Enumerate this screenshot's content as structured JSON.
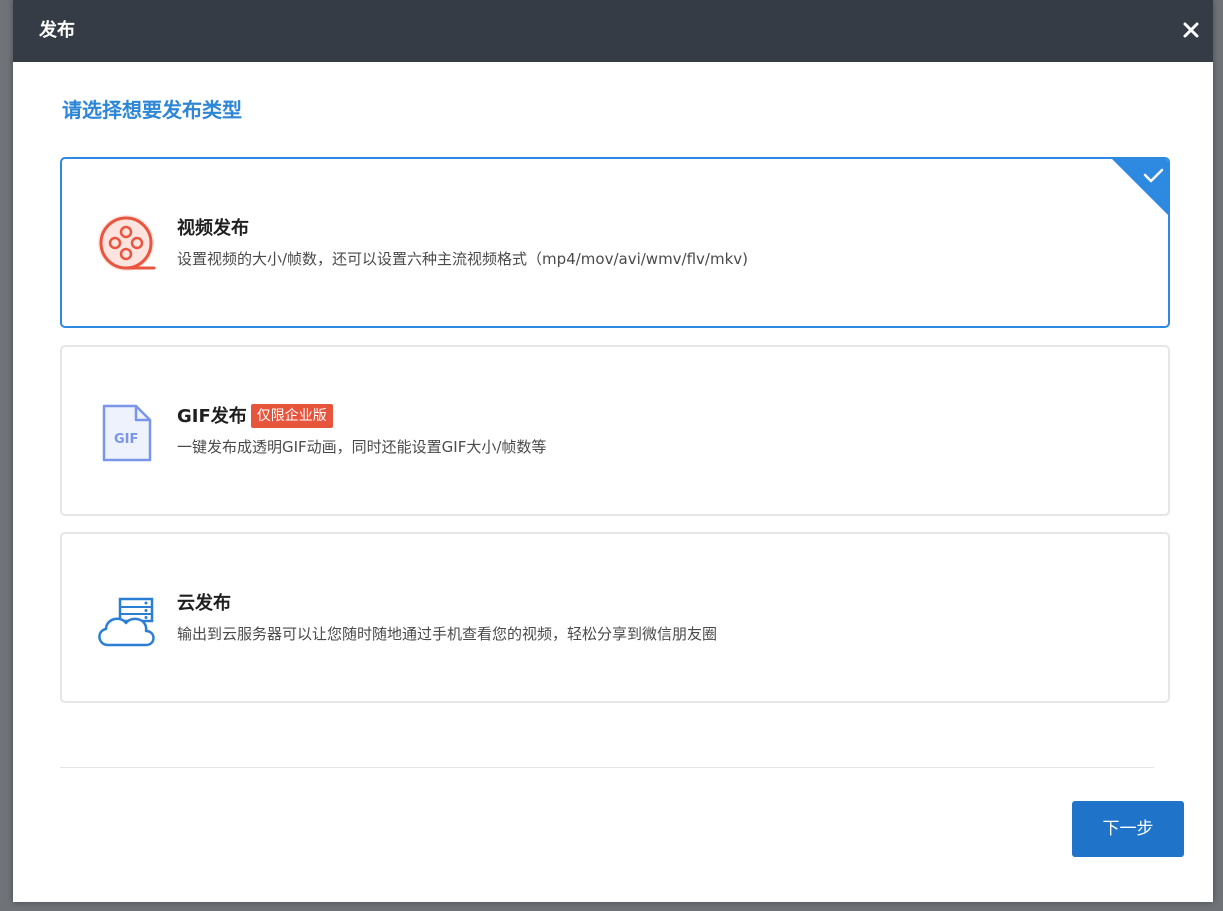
{
  "dialog": {
    "title": "发布",
    "close_icon": "close-icon"
  },
  "heading": "请选择想要发布类型",
  "options": [
    {
      "title": "视频发布",
      "description": "设置视频的大小/帧数，还可以设置六种主流视频格式（mp4/mov/avi/wmv/flv/mkv)",
      "icon": "film-reel-icon",
      "selected": true
    },
    {
      "title": "GIF发布",
      "badge": "仅限企业版",
      "description": "一键发布成透明GIF动画，同时还能设置GIF大小/帧数等",
      "icon": "gif-file-icon",
      "icon_text": "GIF",
      "selected": false
    },
    {
      "title": "云发布",
      "description": "输出到云服务器可以让您随时随地通过手机查看您的视频，轻松分享到微信朋友圈",
      "icon": "cloud-server-icon",
      "selected": false
    }
  ],
  "footer": {
    "next_label": "下一步"
  },
  "colors": {
    "titlebar": "#353c45",
    "accent": "#2e86d6",
    "selected_border": "#2e8ae0",
    "badge": "#e8553d",
    "video_icon": "#e9553f",
    "gif_icon": "#7a96e8",
    "cloud_icon": "#2a7fd4",
    "button": "#1f73c8"
  }
}
